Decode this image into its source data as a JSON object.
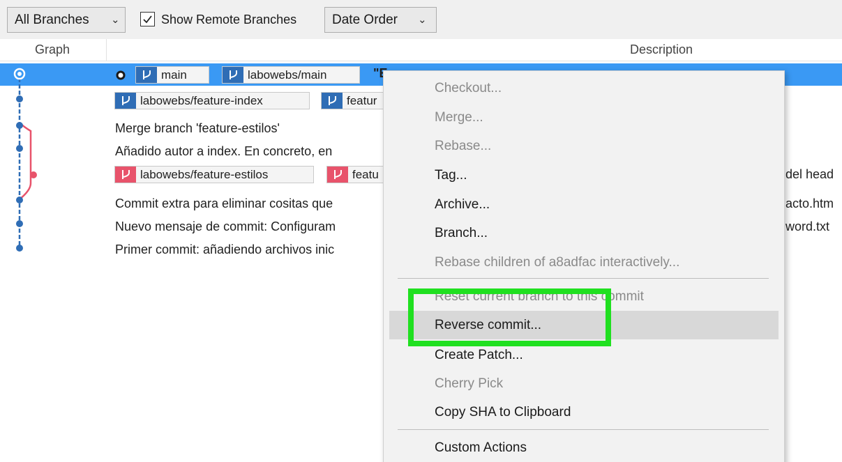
{
  "toolbar": {
    "branches_dropdown": "All Branches",
    "show_remote_label": "Show Remote Branches",
    "show_remote_checked": true,
    "order_dropdown": "Date Order"
  },
  "columns": {
    "graph": "Graph",
    "description": "Description"
  },
  "rows": {
    "r0": {
      "tag1": "main",
      "tag2": "labowebs/main",
      "text": "\"E"
    },
    "r1": {
      "tag1": "labowebs/feature-index",
      "tag2": "featur"
    },
    "r2": {
      "text": "Merge branch 'feature-estilos'"
    },
    "r3": {
      "text": "Añadido autor a index. En concreto, en"
    },
    "r4": {
      "tag1": "labowebs/feature-estilos",
      "tag2": "featu",
      "tail": "del head"
    },
    "r5": {
      "text": "Commit extra para eliminar cositas que",
      "tail": "acto.htm"
    },
    "r6": {
      "text": "Nuevo mensaje de commit: Configuram",
      "tail": "word.txt"
    },
    "r7": {
      "text": "Primer commit: añadiendo archivos inic"
    }
  },
  "context_menu": {
    "checkout": "Checkout...",
    "merge": "Merge...",
    "rebase": "Rebase...",
    "tag": "Tag...",
    "archive": "Archive...",
    "branch": "Branch...",
    "rebase_children": "Rebase children of a8adfac interactively...",
    "reset": "Reset current branch to this commit",
    "reverse": "Reverse commit...",
    "create_patch": "Create Patch...",
    "cherry_pick": "Cherry Pick",
    "copy_sha": "Copy SHA to Clipboard",
    "custom_actions": "Custom Actions"
  },
  "colors": {
    "selection": "#3a99f4",
    "branch_blue": "#2f6db5",
    "branch_red": "#e8536b",
    "highlight_box": "#20e020"
  },
  "icons": {
    "branch": "git-branch-icon",
    "head": "head-ring-icon",
    "check": "checkmark-icon",
    "chevron": "chevron-down-icon"
  }
}
